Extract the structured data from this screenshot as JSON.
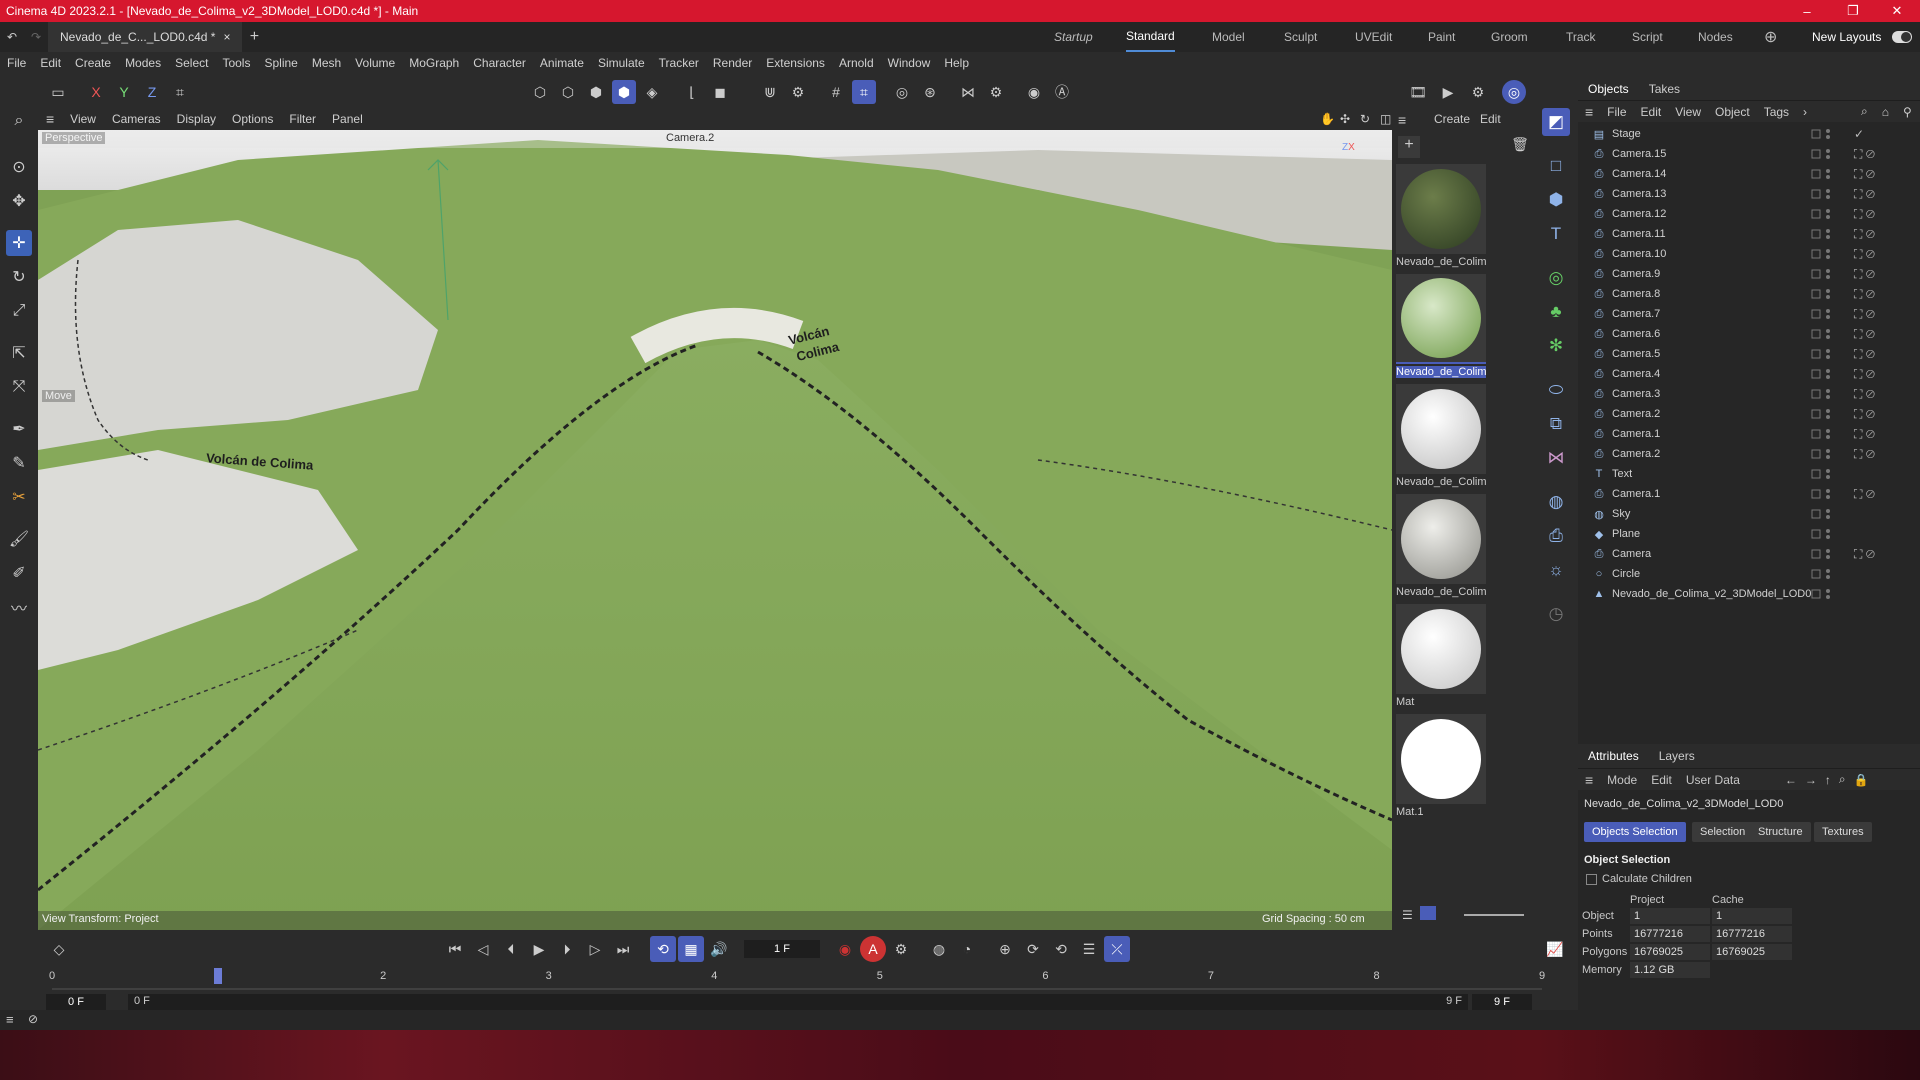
{
  "window": {
    "title": "Cinema 4D 2023.2.1 - [Nevado_de_Colima_v2_3DModel_LOD0.c4d *] - Main",
    "minimize": "–",
    "maximize": "❐",
    "close": "✕"
  },
  "tabs": {
    "document": "Nevado_de_C..._LOD0.c4d *",
    "layouts": [
      "Startup",
      "Standard",
      "Model",
      "Sculpt",
      "UVEdit",
      "Paint",
      "Groom",
      "Track",
      "Script",
      "Nodes"
    ],
    "active_layout": "Standard",
    "new_layouts": "New Layouts"
  },
  "menu": [
    "File",
    "Edit",
    "Create",
    "Modes",
    "Select",
    "Tools",
    "Spline",
    "Mesh",
    "Volume",
    "MoGraph",
    "Character",
    "Animate",
    "Simulate",
    "Tracker",
    "Render",
    "Extensions",
    "Arnold",
    "Window",
    "Help"
  ],
  "toolbar": {
    "axes": [
      "X",
      "Y",
      "Z"
    ]
  },
  "viewport": {
    "menu": [
      "View",
      "Cameras",
      "Display",
      "Options",
      "Filter",
      "Panel"
    ],
    "view_name": "Perspective",
    "camera": "Camera.2",
    "tool_label": "Move",
    "label_1": "Volcán de Colima",
    "label_2a": "Volcán",
    "label_2b": "Colima",
    "view_transform": "View Transform: Project",
    "grid_spacing": "Grid Spacing : 50 cm"
  },
  "materials": {
    "menu": [
      "Create",
      "Edit"
    ],
    "items": [
      {
        "name": "Nevado_de_Colim",
        "color": "#3a4a2a"
      },
      {
        "name": "Nevado_de_Colim",
        "color": "#7fa255"
      },
      {
        "name": "Nevado_de_Colim",
        "color": "#dcdcdc"
      },
      {
        "name": "Nevado_de_Colim",
        "color": "#b8b8b0"
      },
      {
        "name": "Mat",
        "color": "#e6e6e6"
      },
      {
        "name": "Mat.1",
        "color": "#ffffff"
      }
    ]
  },
  "objects": {
    "tabs": [
      "Objects",
      "Takes"
    ],
    "menu": [
      "File",
      "Edit",
      "View",
      "Object",
      "Tags"
    ],
    "items": [
      {
        "name": "Stage",
        "icon": "stage-icon"
      },
      {
        "name": "Camera.15",
        "icon": "camera-icon"
      },
      {
        "name": "Camera.14",
        "icon": "camera-icon"
      },
      {
        "name": "Camera.13",
        "icon": "camera-icon"
      },
      {
        "name": "Camera.12",
        "icon": "camera-icon"
      },
      {
        "name": "Camera.11",
        "icon": "camera-icon"
      },
      {
        "name": "Camera.10",
        "icon": "camera-icon"
      },
      {
        "name": "Camera.9",
        "icon": "camera-icon"
      },
      {
        "name": "Camera.8",
        "icon": "camera-icon"
      },
      {
        "name": "Camera.7",
        "icon": "camera-icon"
      },
      {
        "name": "Camera.6",
        "icon": "camera-icon"
      },
      {
        "name": "Camera.5",
        "icon": "camera-icon"
      },
      {
        "name": "Camera.4",
        "icon": "camera-icon"
      },
      {
        "name": "Camera.3",
        "icon": "camera-icon"
      },
      {
        "name": "Camera.2",
        "icon": "camera-icon"
      },
      {
        "name": "Camera.1",
        "icon": "camera-icon"
      },
      {
        "name": "Camera.2",
        "icon": "camera-icon"
      },
      {
        "name": "Text",
        "icon": "text-icon"
      },
      {
        "name": "Camera.1",
        "icon": "camera-icon"
      },
      {
        "name": "Sky",
        "icon": "sky-icon"
      },
      {
        "name": "Plane",
        "icon": "plane-icon"
      },
      {
        "name": "Camera",
        "icon": "camera-icon"
      },
      {
        "name": "Circle",
        "icon": "circle-icon"
      },
      {
        "name": "Nevado_de_Colima_v2_3DModel_LOD0",
        "icon": "polygon-icon"
      }
    ]
  },
  "attributes": {
    "tabs": [
      "Attributes",
      "Layers"
    ],
    "menu": [
      "Mode",
      "Edit",
      "User Data"
    ],
    "object_name": "Nevado_de_Colima_v2_3DModel_LOD0",
    "subtabs": [
      "Objects Selection",
      "Selection",
      "Structure",
      "Textures"
    ],
    "section": "Object Selection",
    "calc_children": "Calculate Children",
    "col_project": "Project",
    "col_cache": "Cache",
    "rows": [
      {
        "label": "Object",
        "project": "1",
        "cache": "1"
      },
      {
        "label": "Points",
        "project": "16777216",
        "cache": "16777216"
      },
      {
        "label": "Polygons",
        "project": "16769025",
        "cache": "16769025"
      },
      {
        "label": "Memory",
        "project": "1.12 GB",
        "cache": ""
      }
    ]
  },
  "timeline": {
    "current_frame": "1 F",
    "start_frame": "0 F",
    "preview_start": "0 F",
    "preview_end": "9 F",
    "end_frame": "9 F",
    "ruler": [
      "0",
      "1",
      "2",
      "3",
      "4",
      "5",
      "6",
      "7",
      "8",
      "9"
    ],
    "playhead_frame": 1
  }
}
